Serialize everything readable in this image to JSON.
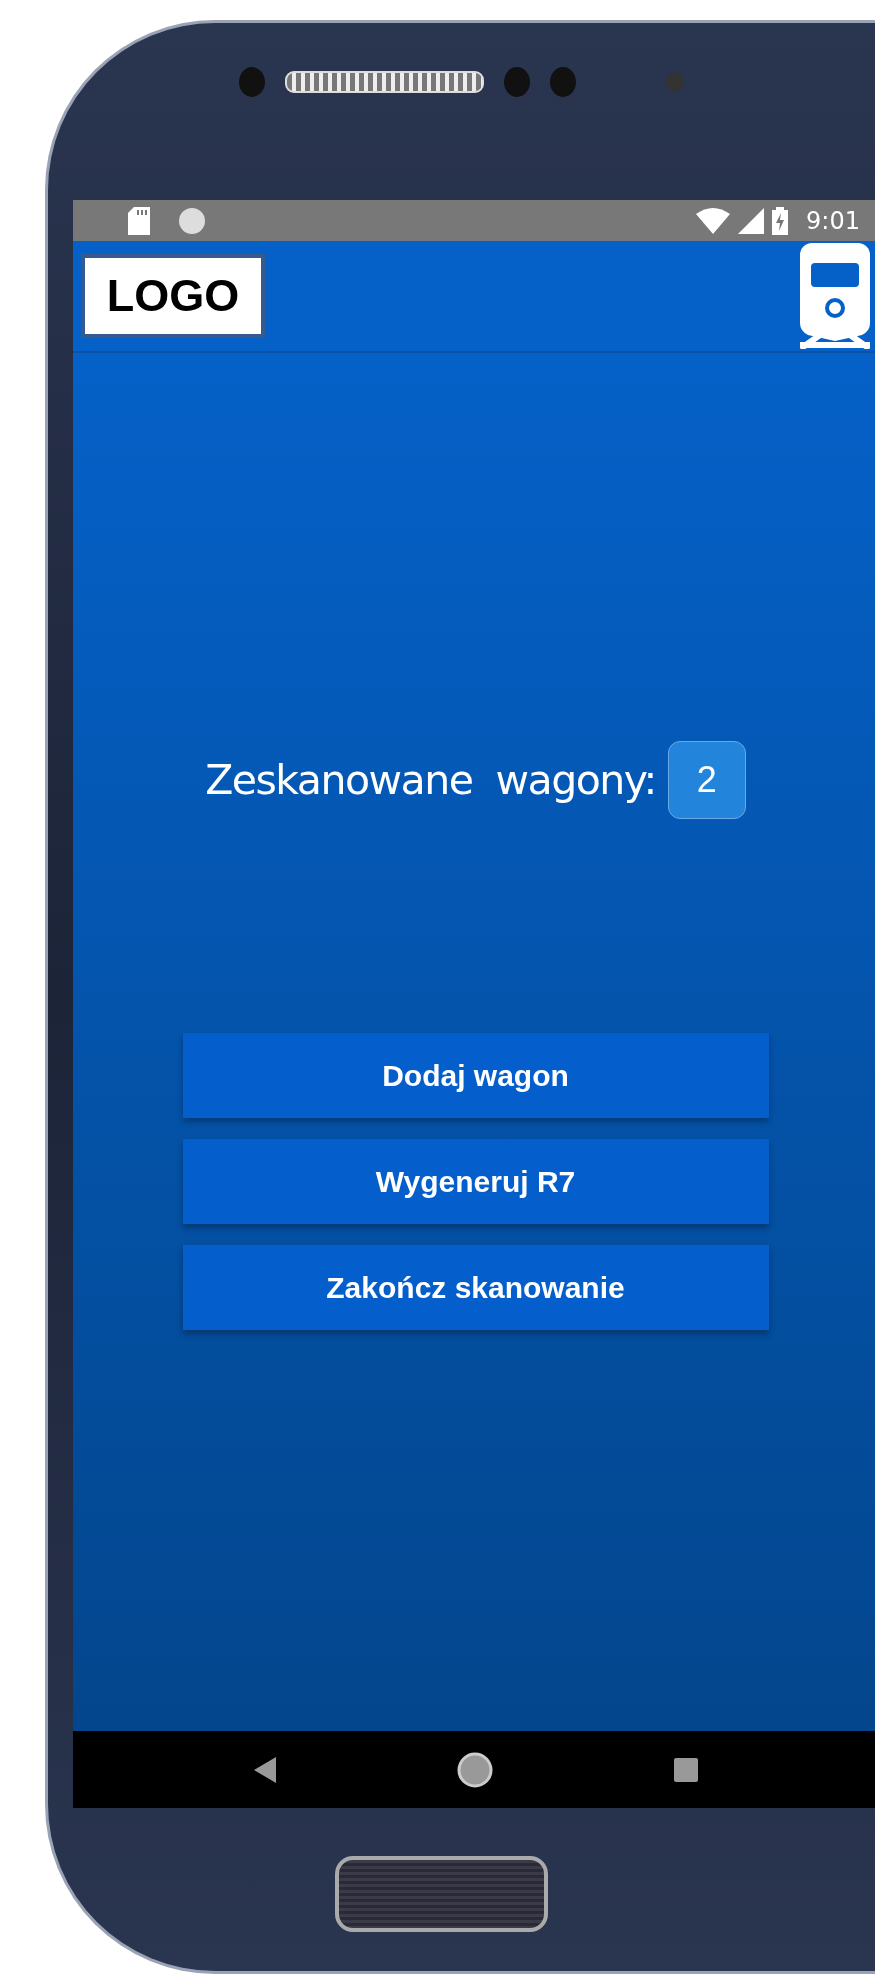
{
  "status_bar": {
    "time": "9:01"
  },
  "app_bar": {
    "logo": "LOGO"
  },
  "counter": {
    "label": "Zeskanowane  wagony:",
    "value": "2"
  },
  "buttons": [
    {
      "label": "Dodaj wagon"
    },
    {
      "label": "Wygeneruj R7"
    },
    {
      "label": "Zakończ skanowanie"
    }
  ]
}
